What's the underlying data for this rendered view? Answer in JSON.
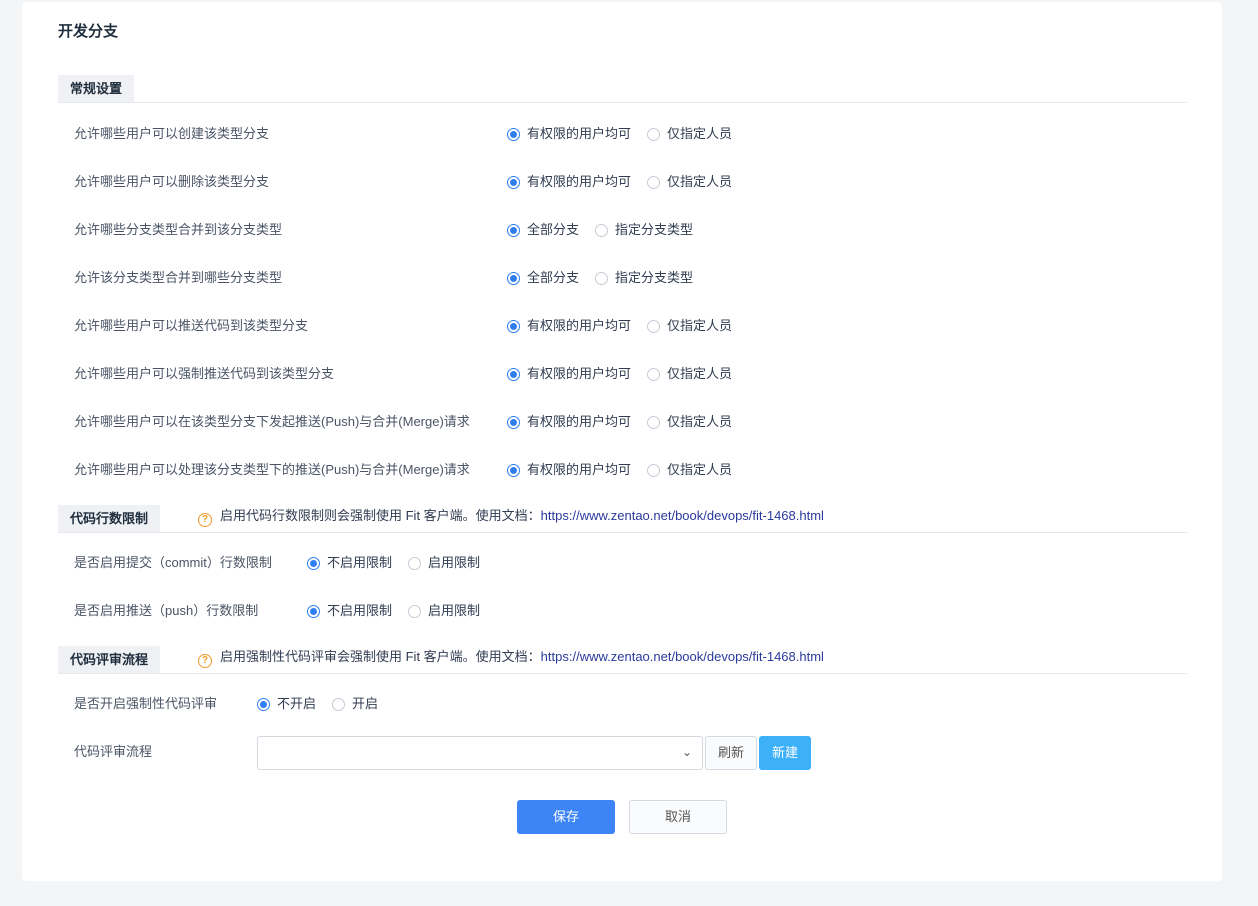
{
  "page_title": "开发分支",
  "general": {
    "title": "常规设置",
    "rows": [
      {
        "label": "允许哪些用户可以创建该类型分支",
        "options": [
          "有权限的用户均可",
          "仅指定人员"
        ],
        "selected": 0
      },
      {
        "label": "允许哪些用户可以删除该类型分支",
        "options": [
          "有权限的用户均可",
          "仅指定人员"
        ],
        "selected": 0
      },
      {
        "label": "允许哪些分支类型合并到该分支类型",
        "options": [
          "全部分支",
          "指定分支类型"
        ],
        "selected": 0
      },
      {
        "label": "允许该分支类型合并到哪些分支类型",
        "options": [
          "全部分支",
          "指定分支类型"
        ],
        "selected": 0
      },
      {
        "label": "允许哪些用户可以推送代码到该类型分支",
        "options": [
          "有权限的用户均可",
          "仅指定人员"
        ],
        "selected": 0
      },
      {
        "label": "允许哪些用户可以强制推送代码到该类型分支",
        "options": [
          "有权限的用户均可",
          "仅指定人员"
        ],
        "selected": 0
      },
      {
        "label": "允许哪些用户可以在该类型分支下发起推送(Push)与合并(Merge)请求",
        "options": [
          "有权限的用户均可",
          "仅指定人员"
        ],
        "selected": 0
      },
      {
        "label": "允许哪些用户可以处理该分支类型下的推送(Push)与合并(Merge)请求",
        "options": [
          "有权限的用户均可",
          "仅指定人员"
        ],
        "selected": 0
      }
    ]
  },
  "line_limit": {
    "title": "代码行数限制",
    "tip": "启用代码行数限制则会强制使用 Fit 客户端。使用文档：",
    "link": "https://www.zentao.net/book/devops/fit-1468.html",
    "rows": [
      {
        "label": "是否启用提交（commit）行数限制",
        "options": [
          "不启用限制",
          "启用限制"
        ],
        "selected": 0
      },
      {
        "label": "是否启用推送（push）行数限制",
        "options": [
          "不启用限制",
          "启用限制"
        ],
        "selected": 0
      }
    ]
  },
  "review": {
    "title": "代码评审流程",
    "tip": "启用强制性代码评审会强制使用 Fit 客户端。使用文档：",
    "link": "https://www.zentao.net/book/devops/fit-1468.html",
    "rows": [
      {
        "label": "是否开启强制性代码评审",
        "options": [
          "不开启",
          "开启"
        ],
        "selected": 0
      }
    ],
    "flow_label": "代码评审流程",
    "flow_value": "",
    "refresh": "刷新",
    "new": "新建"
  },
  "actions": {
    "save": "保存",
    "cancel": "取消"
  },
  "colors": {
    "primary": "#3d85f6",
    "new_button": "#3cb0f9",
    "tip": "#f39a2c"
  }
}
